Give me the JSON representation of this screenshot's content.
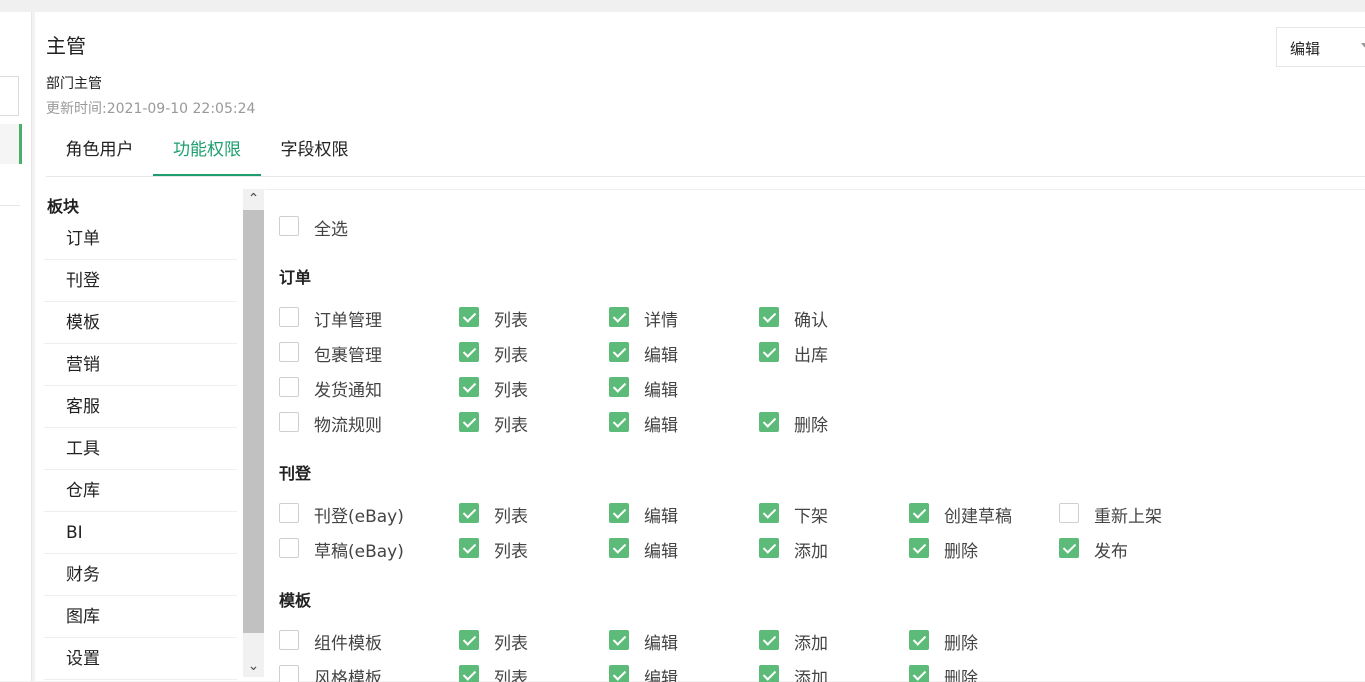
{
  "role": {
    "title": "主管",
    "description": "部门主管",
    "updated": "更新时间:2021-09-10 22:05:24"
  },
  "action_select": {
    "value": "编辑"
  },
  "tabs": [
    {
      "label": "角色用户",
      "active": false
    },
    {
      "label": "功能权限",
      "active": true
    },
    {
      "label": "字段权限",
      "active": false
    }
  ],
  "modules": {
    "heading": "板块",
    "items": [
      "订单",
      "刊登",
      "模板",
      "营销",
      "客服",
      "工具",
      "仓库",
      "BI",
      "财务",
      "图库",
      "设置"
    ]
  },
  "select_all": {
    "label": "全选",
    "checked": false
  },
  "sections": [
    {
      "title": "订单",
      "rows": [
        {
          "name": "订单管理",
          "checked": false,
          "perms": [
            {
              "label": "列表",
              "checked": true
            },
            {
              "label": "详情",
              "checked": true
            },
            {
              "label": "确认",
              "checked": true
            }
          ]
        },
        {
          "name": "包裹管理",
          "checked": false,
          "perms": [
            {
              "label": "列表",
              "checked": true
            },
            {
              "label": "编辑",
              "checked": true
            },
            {
              "label": "出库",
              "checked": true
            }
          ]
        },
        {
          "name": "发货通知",
          "checked": false,
          "perms": [
            {
              "label": "列表",
              "checked": true
            },
            {
              "label": "编辑",
              "checked": true
            }
          ]
        },
        {
          "name": "物流规则",
          "checked": false,
          "perms": [
            {
              "label": "列表",
              "checked": true
            },
            {
              "label": "编辑",
              "checked": true
            },
            {
              "label": "删除",
              "checked": true
            }
          ]
        }
      ]
    },
    {
      "title": "刊登",
      "rows": [
        {
          "name": "刊登(eBay)",
          "checked": false,
          "perms": [
            {
              "label": "列表",
              "checked": true
            },
            {
              "label": "编辑",
              "checked": true
            },
            {
              "label": "下架",
              "checked": true
            },
            {
              "label": "创建草稿",
              "checked": true
            },
            {
              "label": "重新上架",
              "checked": false
            }
          ]
        },
        {
          "name": "草稿(eBay)",
          "checked": false,
          "perms": [
            {
              "label": "列表",
              "checked": true
            },
            {
              "label": "编辑",
              "checked": true
            },
            {
              "label": "添加",
              "checked": true
            },
            {
              "label": "删除",
              "checked": true
            },
            {
              "label": "发布",
              "checked": true
            }
          ]
        }
      ]
    },
    {
      "title": "模板",
      "rows": [
        {
          "name": "组件模板",
          "checked": false,
          "perms": [
            {
              "label": "列表",
              "checked": true
            },
            {
              "label": "编辑",
              "checked": true
            },
            {
              "label": "添加",
              "checked": true
            },
            {
              "label": "删除",
              "checked": true
            }
          ]
        },
        {
          "name": "风格模板",
          "checked": false,
          "perms": [
            {
              "label": "列表",
              "checked": true
            },
            {
              "label": "编辑",
              "checked": true
            },
            {
              "label": "添加",
              "checked": true
            },
            {
              "label": "删除",
              "checked": true
            }
          ]
        }
      ]
    }
  ],
  "colors": {
    "accent": "#1e9e6e",
    "checkbox_checked": "#5dbb7a"
  },
  "icons": {
    "scroll_up": "chevron-up-icon",
    "scroll_down": "chevron-down-icon",
    "select_caret": "caret-down-icon"
  }
}
